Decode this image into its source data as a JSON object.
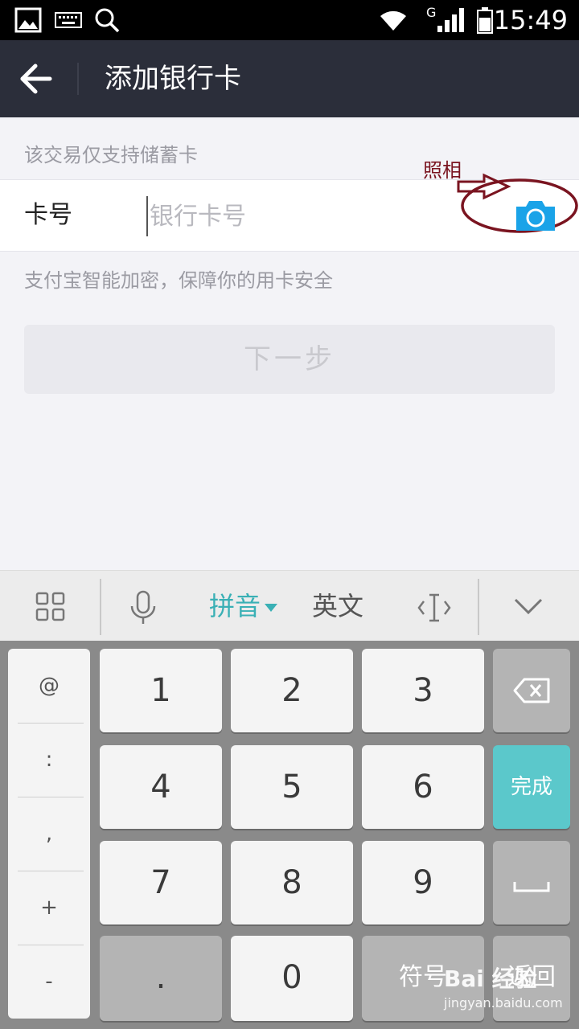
{
  "status_bar": {
    "time": "15:49",
    "network": "G",
    "icons": [
      "image-icon",
      "keyboard-icon",
      "search-icon",
      "wifi-icon",
      "signal-icon",
      "battery-icon"
    ]
  },
  "header": {
    "title": "添加银行卡",
    "back_icon": "back-arrow-icon"
  },
  "form": {
    "notice": "该交易仅支持储蓄卡",
    "card_label": "卡号",
    "card_placeholder": "银行卡号",
    "camera_icon": "camera-icon",
    "annotation": "照相",
    "security_text": "支付宝智能加密，保障你的用卡安全",
    "next_button": "下一步"
  },
  "keyboard_toolbar": {
    "pinyin": "拼音",
    "english": "英文",
    "icons": [
      "grid-icon",
      "microphone-icon",
      "cursor-icon",
      "collapse-icon"
    ]
  },
  "keyboard": {
    "symbols": [
      "@",
      ":",
      ",",
      "+",
      "-"
    ],
    "numbers": [
      "1",
      "2",
      "3",
      "4",
      "5",
      "6",
      "7",
      "8",
      "9"
    ],
    "dot": ".",
    "zero": "0",
    "symbol_key": "符号",
    "done": "完成",
    "return_key": "返回",
    "accent_color": "#5bc8cb"
  },
  "watermark": {
    "text": "Bai 经验",
    "url": "jingyan.baidu.com"
  }
}
